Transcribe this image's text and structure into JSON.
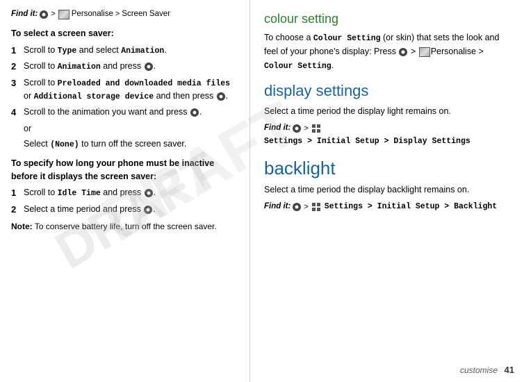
{
  "left": {
    "find_it_prefix": "Find it:",
    "find_it_suffix_personalise": "Personalise",
    "find_it_suffix_screen_saver": "Screen Saver",
    "to_select": "To select a screen saver",
    "steps": [
      {
        "num": "1",
        "text_start": "Scroll to ",
        "bold1": "Type",
        "text_mid": " and select ",
        "bold2": "Animation",
        "text_end": "."
      },
      {
        "num": "2",
        "text_start": "Scroll to ",
        "bold1": "Animation",
        "text_mid": " and press ",
        "text_end": "."
      },
      {
        "num": "3",
        "text_start": "Scroll to ",
        "bold1": "Preloaded and downloaded media files",
        "text_mid": " or ",
        "bold2": "Additional storage device",
        "text_end": " and then press",
        "text_end2": "."
      },
      {
        "num": "4",
        "text_start": "Scroll to the animation you want and press",
        "text_end": "."
      }
    ],
    "or_label": "or",
    "select_none": "Select ",
    "none_bold": "(None)",
    "turn_off": " to turn off the screen saver.",
    "to_specify_bold": "To specify how long your phone must be inactive before it displays the screen saver",
    "steps2": [
      {
        "num": "1",
        "text_start": "Scroll to ",
        "bold1": "Idle Time",
        "text_mid": " and press",
        "text_end": "."
      },
      {
        "num": "2",
        "text_start": "Select a time period and press",
        "text_end": "."
      }
    ],
    "note_label": "Note:",
    "note_text": " To conserve battery life, turn off the screen saver."
  },
  "right": {
    "colour_title": "colour setting",
    "colour_body1": "To choose a ",
    "colour_bold": "Colour Setting",
    "colour_body2": " (or skin) that sets the look and feel of your phone's display: Press",
    "colour_personalise": "Personalise",
    "colour_body3": "Colour Setting",
    "colour_body3_pre": "> ",
    "colour_body3_post": ".",
    "display_title": "display settings",
    "display_body": "Select a time period the display light remains on.",
    "display_find_it": "Find it:",
    "display_path": "Settings > Initial Setup > Display Settings",
    "backlight_title": "backlight",
    "backlight_body": "Select a time period the display backlight remains on.",
    "backlight_find_it": "Find it:",
    "backlight_path": "Settings > Initial Setup > Backlight",
    "page_label": "customise",
    "page_num": "41"
  }
}
